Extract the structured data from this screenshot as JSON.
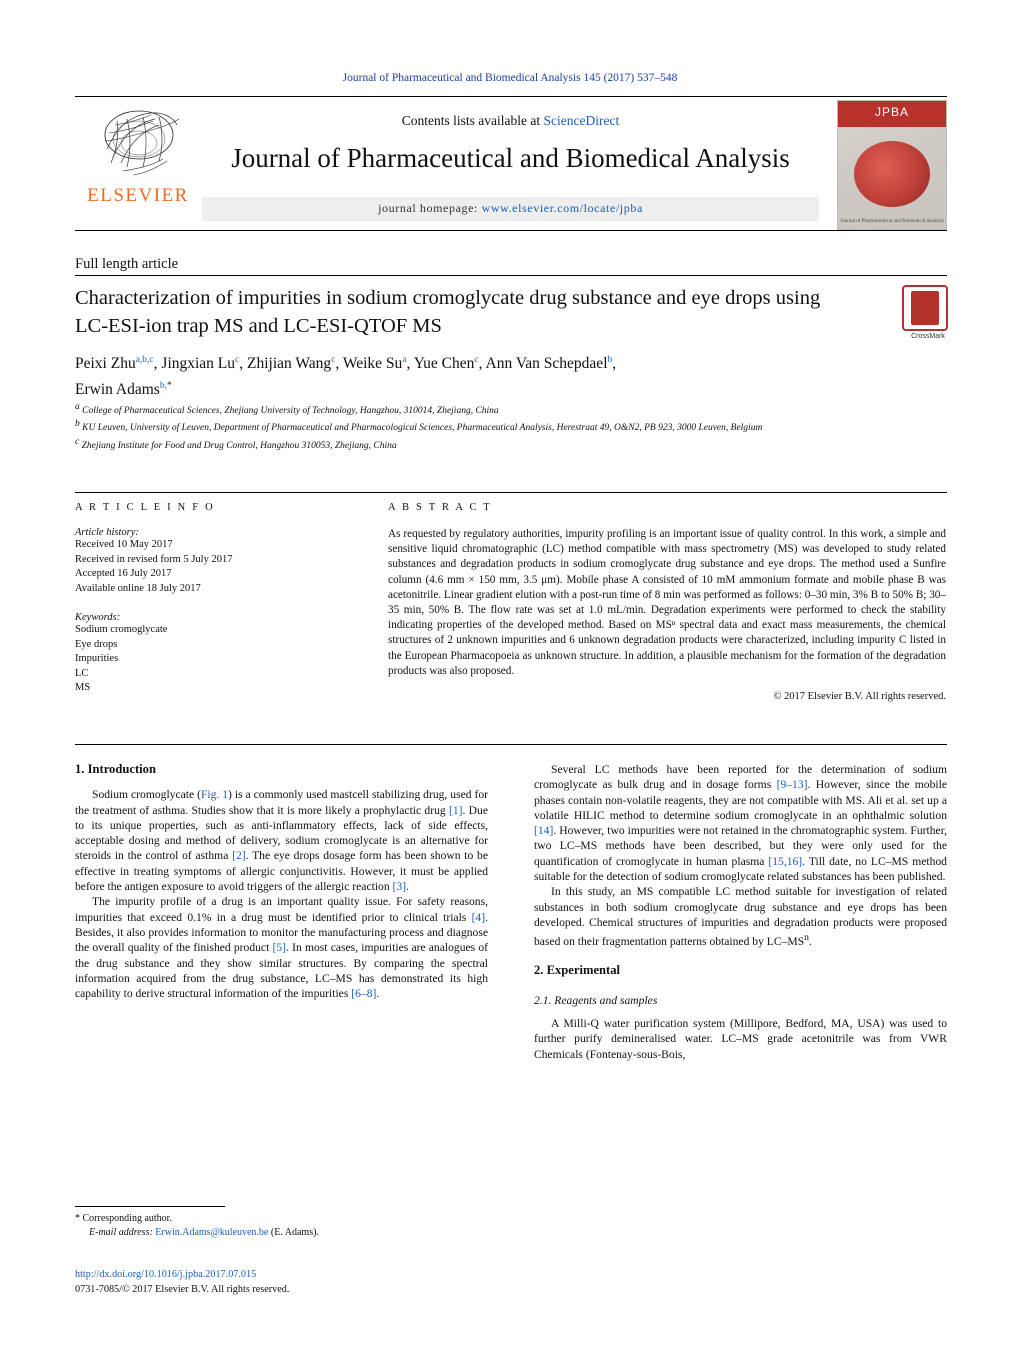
{
  "running_head": "Journal of Pharmaceutical and Biomedical Analysis 145 (2017) 537–548",
  "masthead": {
    "contents_prefix": "Contents lists available at ",
    "contents_link": "ScienceDirect",
    "journal_title": "Journal of Pharmaceutical and Biomedical Analysis",
    "homepage_label": "journal homepage: ",
    "homepage_url": "www.elsevier.com/locate/jpba",
    "publisher": "ELSEVIER",
    "cover_badge": "JPBA",
    "cover_caption": "Journal of Pharmaceutical and Biomedical Analysis"
  },
  "article": {
    "type": "Full length article",
    "title": "Characterization of impurities in sodium cromoglycate drug substance and eye drops using LC-ESI-ion trap MS and LC-ESI-QTOF MS",
    "crossmark_label": "CrossMark",
    "authors_line1_pre": "Peixi Zhu",
    "authors": [
      {
        "name": "Peixi Zhu",
        "sup": "a,b,c"
      },
      {
        "name": "Jingxian Lu",
        "sup": "c"
      },
      {
        "name": "Zhijian Wang",
        "sup": "c"
      },
      {
        "name": "Weike Su",
        "sup": "a"
      },
      {
        "name": "Yue Chen",
        "sup": "c"
      },
      {
        "name": "Ann Van Schepdael",
        "sup": "b"
      },
      {
        "name": "Erwin Adams",
        "sup": "b,*"
      }
    ],
    "affiliations": [
      {
        "sup": "a",
        "text": "College of Pharmaceutical Sciences, Zhejiang University of Technology, Hangzhou, 310014, Zhejiang, China"
      },
      {
        "sup": "b",
        "text": "KU Leuven, University of Leuven, Department of Pharmaceutical and Pharmacological Sciences, Pharmaceutical Analysis, Herestraat 49, O&N2, PB 923, 3000 Leuven, Belgium"
      },
      {
        "sup": "c",
        "text": "Zhejiang Institute for Food and Drug Control, Hangzhou 310053, Zhejiang, China"
      }
    ]
  },
  "article_info": {
    "heading": "A R T I C L E   I N F O",
    "history_label": "Article history:",
    "history": [
      "Received 10 May 2017",
      "Received in revised form 5 July 2017",
      "Accepted 16 July 2017",
      "Available online 18 July 2017"
    ],
    "keywords_label": "Keywords:",
    "keywords": [
      "Sodium cromoglycate",
      "Eye drops",
      "Impurities",
      "LC",
      "MS"
    ]
  },
  "abstract": {
    "heading": "A B S T R A C T",
    "body": "As requested by regulatory authorities, impurity profiling is an important issue of quality control. In this work, a simple and sensitive liquid chromatographic (LC) method compatible with mass spectrometry (MS) was developed to study related substances and degradation products in sodium cromoglycate drug substance and eye drops. The method used a Sunfire column (4.6 mm × 150 mm, 3.5 μm). Mobile phase A consisted of 10 mM ammonium formate and mobile phase B was acetonitrile. Linear gradient elution with a post-run time of 8 min was performed as follows: 0–30 min, 3% B to 50% B; 30–35 min, 50% B. The flow rate was set at 1.0 mL/min. Degradation experiments were performed to check the stability indicating properties of the developed method. Based on MSⁿ spectral data and exact mass measurements, the chemical structures of 2 unknown impurities and 6 unknown degradation products were characterized, including impurity C listed in the European Pharmacopoeia as unknown structure. In addition, a plausible mechanism for the formation of the degradation products was also proposed.",
    "copyright": "© 2017 Elsevier B.V. All rights reserved."
  },
  "sections": {
    "introduction_heading": "1.  Introduction",
    "intro_p1": "Sodium cromoglycate (Fig. 1) is a commonly used mastcell stabilizing drug, used for the treatment of asthma. Studies show that it is more likely a prophylactic drug [1]. Due to its unique properties, such as anti-inflammatory effects, lack of side effects, acceptable dosing and method of delivery, sodium cromoglycate is an alternative for steroids in the control of asthma [2]. The eye drops dosage form has been shown to be effective in treating symptoms of allergic conjunctivitis. However, it must be applied before the antigen exposure to avoid triggers of the allergic reaction [3].",
    "intro_p2": "The impurity profile of a drug is an important quality issue. For safety reasons, impurities that exceed 0.1% in a drug must be identified prior to clinical trials [4]. Besides, it also provides information to monitor the manufacturing process and diagnose the overall quality of the finished product [5]. In most cases, impurities are analogues of the drug substance and they show similar structures. By comparing the spectral information acquired from the drug substance, LC–MS has demonstrated its high capability to derive structural information of the impurities [6–8].",
    "intro_p3": "Several LC methods have been reported for the determination of sodium cromoglycate as bulk drug and in dosage forms [9–13]. However, since the mobile phases contain non-volatile reagents, they are not compatible with MS. Ali et al. set up a volatile HILIC method to determine sodium cromoglycate in an ophthalmic solution [14]. However, two impurities were not retained in the chromatographic system. Further, two LC–MS methods have been described, but they were only used for the quantification of cromoglycate in human plasma [15,16]. Till date, no LC–MS method suitable for the detection of sodium cromoglycate related substances has been published.",
    "intro_p4": "In this study, an MS compatible LC method suitable for investigation of related substances in both sodium cromoglycate drug substance and eye drops has been developed. Chemical structures of impurities and degradation products were proposed based on their fragmentation patterns obtained by LC–MSⁿ.",
    "experimental_heading": "2.  Experimental",
    "exp_sub_heading": "2.1.  Reagents and samples",
    "exp_p1": "A Milli-Q water purification system (Millipore, Bedford, MA, USA) was used to further purify demineralised water. LC–MS grade acetonitrile was from VWR Chemicals (Fontenay-sous-Bois,"
  },
  "footer": {
    "corresponding_marker": "*",
    "corresponding_text": "Corresponding author.",
    "email_label": "E-mail address: ",
    "email": "Erwin.Adams@kuleuven.be",
    "email_suffix": " (E. Adams).",
    "doi": "http://dx.doi.org/10.1016/j.jpba.2017.07.015",
    "issn_line": "0731-7085/© 2017 Elsevier B.V. All rights reserved."
  }
}
